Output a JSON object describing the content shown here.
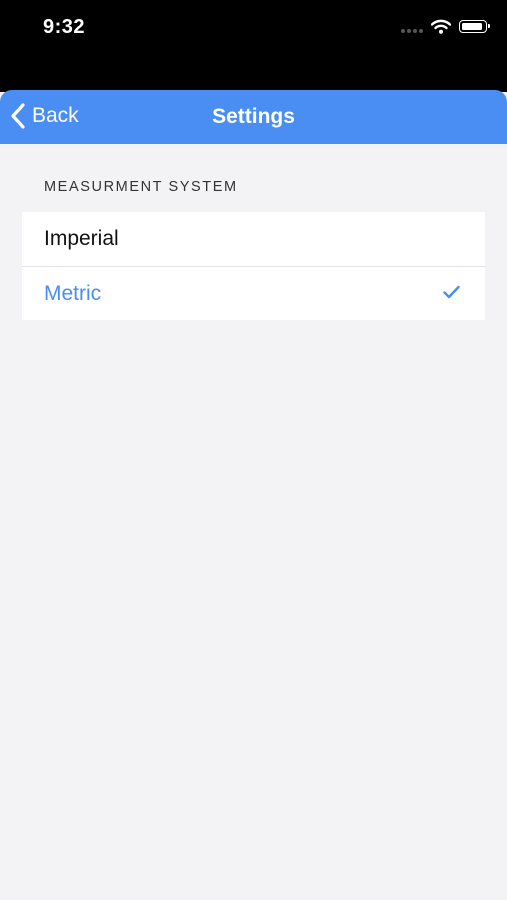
{
  "status_bar": {
    "time": "9:32",
    "icons": [
      "signal-icon",
      "wifi-icon",
      "battery-icon"
    ]
  },
  "nav": {
    "back_label": "Back",
    "title": "Settings",
    "background_color": "#4a8ef3"
  },
  "section": {
    "header": "MEASURMENT SYSTEM",
    "options": [
      {
        "label": "Imperial",
        "selected": false
      },
      {
        "label": "Metric",
        "selected": true
      }
    ]
  },
  "colors": {
    "accent": "#4a8ef3",
    "page_background": "#f3f3f5"
  }
}
